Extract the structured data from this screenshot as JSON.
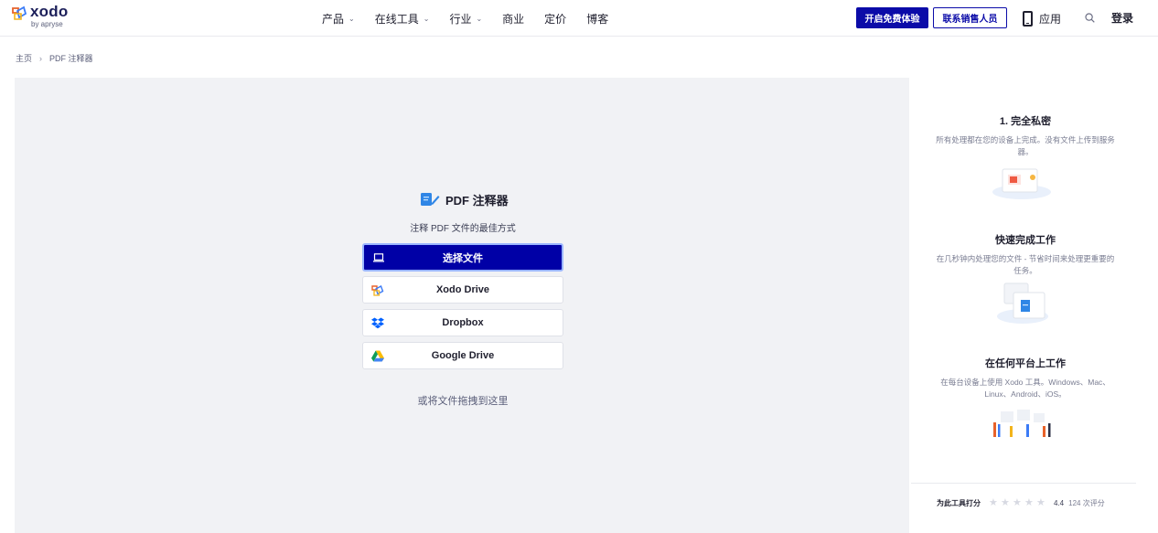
{
  "header": {
    "logo_text": "xodo",
    "logo_sub": "by apryse",
    "nav": [
      {
        "label": "产品",
        "dropdown": true
      },
      {
        "label": "在线工具",
        "dropdown": true
      },
      {
        "label": "行业",
        "dropdown": true
      },
      {
        "label": "商业",
        "dropdown": false
      },
      {
        "label": "定价",
        "dropdown": false
      },
      {
        "label": "博客",
        "dropdown": false
      }
    ],
    "trial_button": "开启免费体验",
    "sales_button": "联系销售人员",
    "apps_label": "应用",
    "login_label": "登录"
  },
  "breadcrumb": {
    "home": "主页",
    "current": "PDF 注释器"
  },
  "tool": {
    "title": "PDF 注释器",
    "subtitle": "注释 PDF 文件的最佳方式",
    "choose_file": "选择文件",
    "sources": [
      {
        "label": "Xodo Drive",
        "icon": "xodo-drive-icon"
      },
      {
        "label": "Dropbox",
        "icon": "dropbox-icon"
      },
      {
        "label": "Google Drive",
        "icon": "google-drive-icon"
      }
    ],
    "drop_hint": "或将文件拖拽到这里"
  },
  "features": [
    {
      "title": "1. 完全私密",
      "desc": "所有处理都在您的设备上完成。没有文件上传到服务器。"
    },
    {
      "title": "快速完成工作",
      "desc": "在几秒钟内处理您的文件 - 节省时间来处理更重要的任务。"
    },
    {
      "title": "在任何平台上工作",
      "desc": "在每台设备上使用 Xodo 工具。Windows、Mac、Linux、Android、iOS。"
    }
  ],
  "rating": {
    "label": "为此工具打分",
    "score": "4.4",
    "count": "124 次评分",
    "stars_filled": 0,
    "stars_total": 5
  },
  "colors": {
    "brand_blue": "#0b0ba8",
    "panel_bg": "#f1f2f5"
  }
}
